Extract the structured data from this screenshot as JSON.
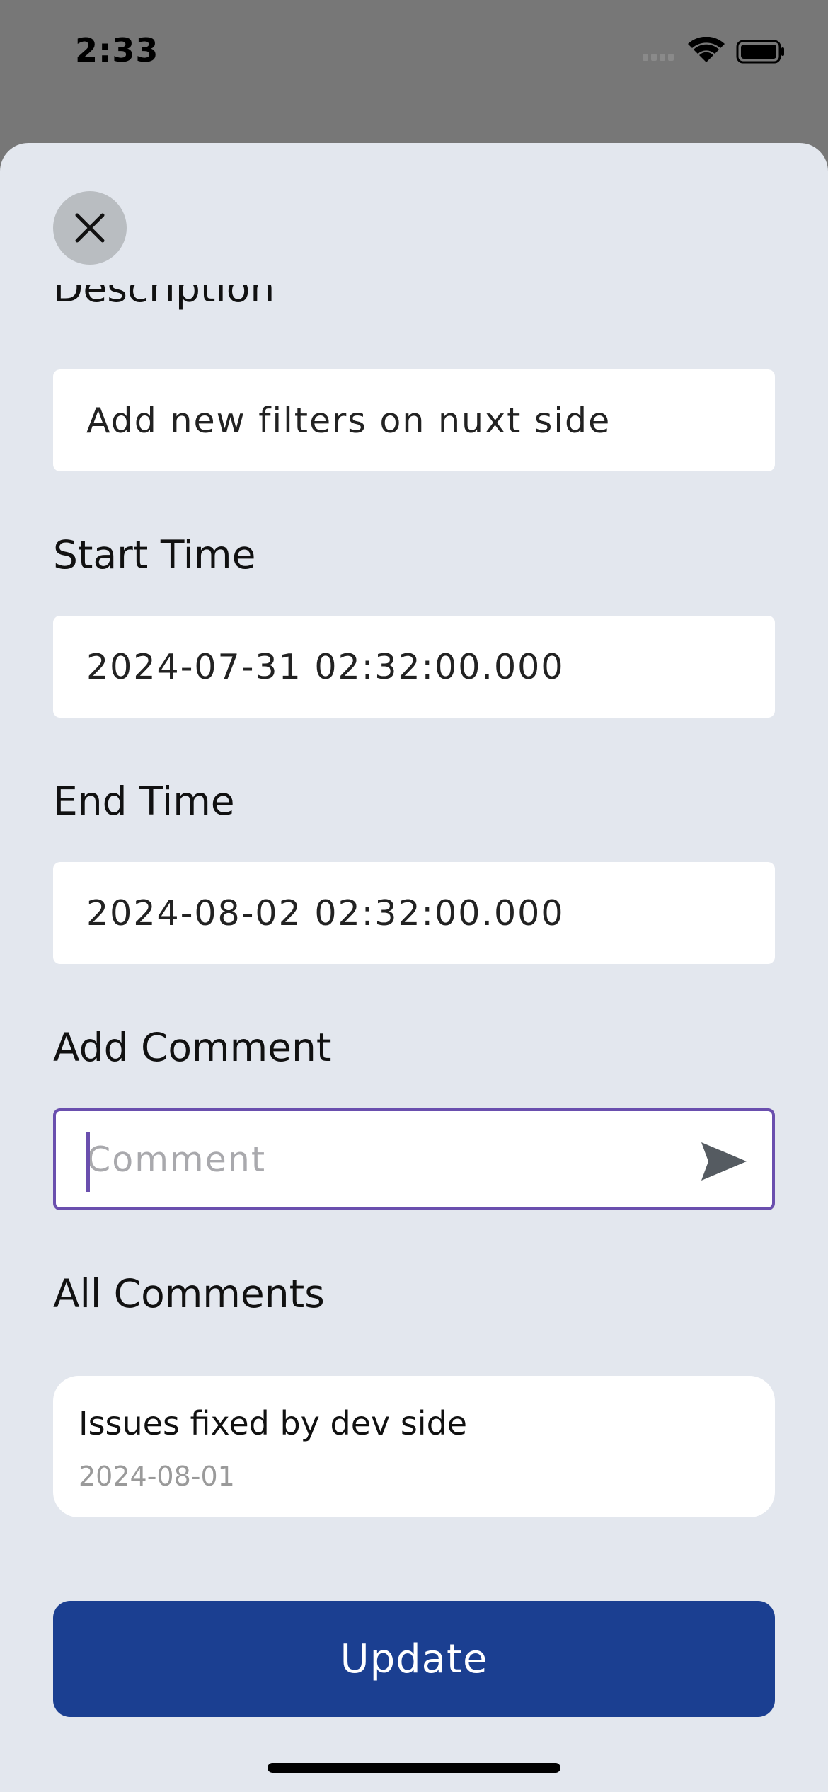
{
  "status": {
    "time": "2:33",
    "icons": [
      "cellular-signal-icon",
      "wifi-icon",
      "battery-icon"
    ]
  },
  "form": {
    "description_label": "Description",
    "description_value": "Add new filters on nuxt side",
    "start_label": "Start Time",
    "start_value": "2024-07-31 02:32:00.000",
    "end_label": "End Time",
    "end_value": "2024-08-02 02:32:00.000",
    "add_comment_label": "Add Comment",
    "comment_placeholder": "Comment",
    "all_comments_label": "All Comments",
    "comments": [
      {
        "text": "Issues fixed by dev side",
        "date": "2024-08-01"
      }
    ],
    "update_label": "Update"
  },
  "colors": {
    "sheet_bg": "#e3e7ee",
    "accent_border": "#6a4fae",
    "primary_button": "#1b3f91"
  }
}
